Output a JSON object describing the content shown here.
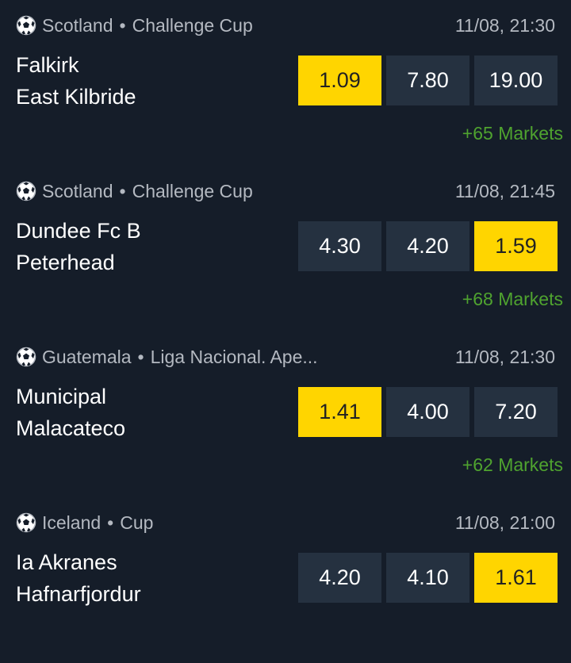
{
  "matches": [
    {
      "country": "Scotland",
      "competition": "Challenge Cup",
      "time": "11/08, 21:30",
      "home": "Falkirk",
      "away": "East Kilbride",
      "odds": [
        "1.09",
        "7.80",
        "19.00"
      ],
      "selected_index": 0,
      "markets": "+65 Markets"
    },
    {
      "country": "Scotland",
      "competition": "Challenge Cup",
      "time": "11/08, 21:45",
      "home": "Dundee Fc B",
      "away": "Peterhead",
      "odds": [
        "4.30",
        "4.20",
        "1.59"
      ],
      "selected_index": 2,
      "markets": "+68 Markets"
    },
    {
      "country": "Guatemala",
      "competition": "Liga Nacional. Ape...",
      "time": "11/08, 21:30",
      "home": "Municipal",
      "away": "Malacateco",
      "odds": [
        "1.41",
        "4.00",
        "7.20"
      ],
      "selected_index": 0,
      "markets": "+62 Markets"
    },
    {
      "country": "Iceland",
      "competition": "Cup",
      "time": "11/08, 21:00",
      "home": "Ia Akranes",
      "away": "Hafnarfjordur",
      "odds": [
        "4.20",
        "4.10",
        "1.61"
      ],
      "selected_index": 2,
      "markets": ""
    }
  ],
  "separator": "•",
  "icon": "soccer-ball-icon",
  "colors": {
    "background": "#151d29",
    "odd_button": "#253140",
    "selected_odd": "#ffd500",
    "markets_link": "#4fa32f",
    "muted_text": "#b4b9c1"
  }
}
